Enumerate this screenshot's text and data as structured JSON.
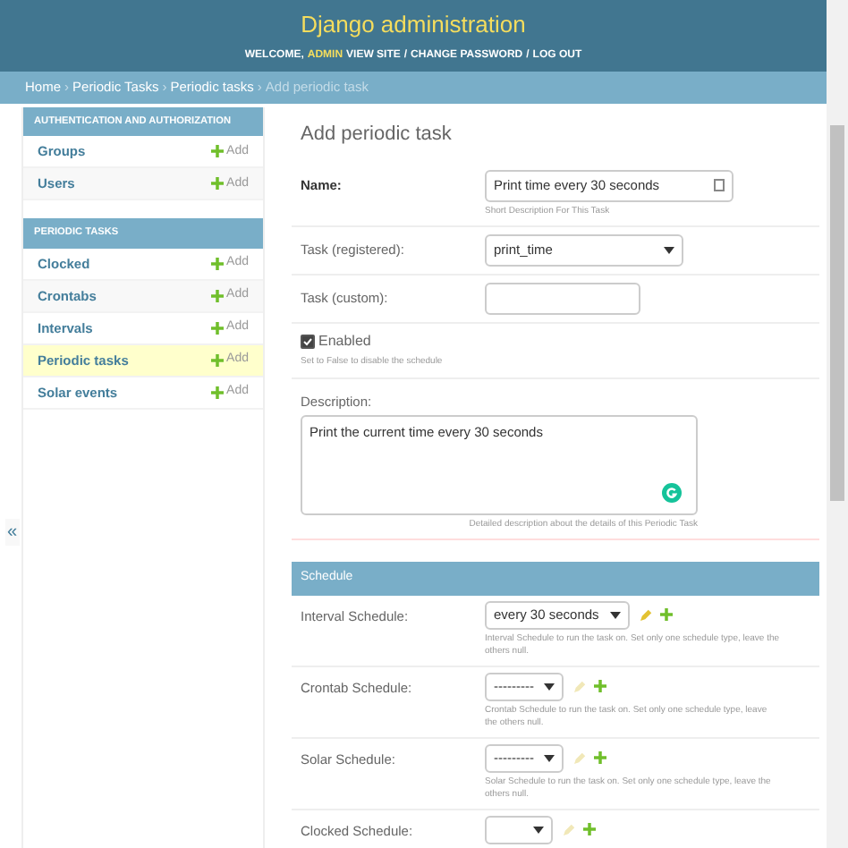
{
  "header": {
    "title": "Django administration",
    "welcome": "WELCOME,",
    "user": "ADMIN",
    "links": [
      "VIEW SITE",
      "CHANGE PASSWORD",
      "LOG OUT"
    ],
    "separator": "/"
  },
  "breadcrumbs": {
    "links": [
      "Home",
      "Periodic Tasks",
      "Periodic tasks"
    ],
    "current": "Add periodic task",
    "separator": "›"
  },
  "sidebar": {
    "modules": [
      {
        "title": "AUTHENTICATION AND AUTHORIZATION",
        "items": [
          {
            "label": "Groups",
            "add": "Add",
            "selected": false
          },
          {
            "label": "Users",
            "add": "Add",
            "selected": false
          }
        ]
      },
      {
        "title": "PERIODIC TASKS",
        "items": [
          {
            "label": "Clocked",
            "add": "Add",
            "selected": false
          },
          {
            "label": "Crontabs",
            "add": "Add",
            "selected": false
          },
          {
            "label": "Intervals",
            "add": "Add",
            "selected": false
          },
          {
            "label": "Periodic tasks",
            "add": "Add",
            "selected": true
          },
          {
            "label": "Solar events",
            "add": "Add",
            "selected": false
          }
        ]
      }
    ],
    "collapse": "«"
  },
  "form": {
    "title": "Add periodic task",
    "fields": [
      {
        "kind": "text",
        "label": "Name:",
        "required": true,
        "value": "Print time every 30 seconds",
        "help": "Short Description For This Task"
      },
      {
        "kind": "select",
        "label": "Task (registered):",
        "required": false,
        "value": "print_time"
      },
      {
        "kind": "text",
        "label": "Task (custom):",
        "required": false
      },
      {
        "kind": "checkbox",
        "label": "Enabled",
        "checked": true,
        "help": "Set to False to disable the schedule"
      },
      {
        "kind": "textarea",
        "label": "Description:",
        "value": "Print the current time every 30 seconds",
        "help": "Detailed description about the details of this Periodic Task"
      }
    ],
    "schedule": {
      "title": "Schedule",
      "rows": [
        {
          "label": "Interval Schedule:",
          "value": "every 30 seconds",
          "edit_enabled": true,
          "help": "Interval Schedule to run the task on.  Set only one schedule type, leave the others null."
        },
        {
          "label": "Crontab Schedule:",
          "value": "---------",
          "edit_enabled": false,
          "help": "Crontab Schedule to run the task on.  Set only one schedule type, leave the others null."
        },
        {
          "label": "Solar Schedule:",
          "value": "---------",
          "edit_enabled": false,
          "help": "Solar Schedule to run the task on.  Set only one schedule type, leave the others null."
        },
        {
          "label": "Clocked Schedule:",
          "edit_enabled": false
        }
      ]
    }
  }
}
